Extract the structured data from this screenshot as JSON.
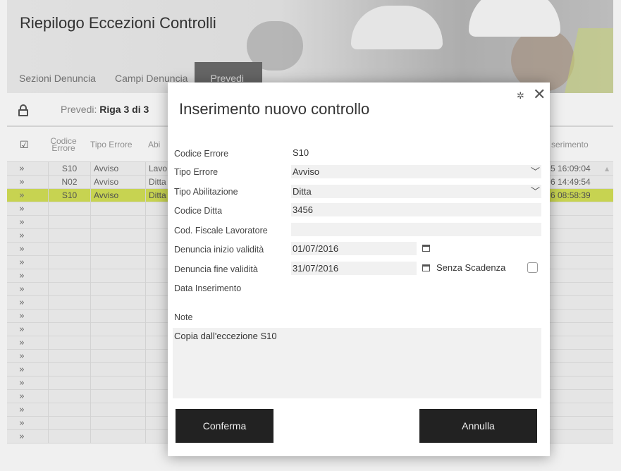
{
  "app": {
    "title": "Riepilogo Eccezioni Controlli",
    "tabs": [
      {
        "label": "Sezioni Denuncia",
        "active": false
      },
      {
        "label": "Campi Denuncia",
        "active": false
      },
      {
        "label": "Prevedi",
        "active": true
      }
    ],
    "record_prefix": "Prevedi:",
    "record_position": "Riga 3 di 3"
  },
  "table": {
    "headers": {
      "codice_errore": "Codice Errore",
      "tipo_errore": "Tipo Errore",
      "abilitazione": "Abi",
      "inserimento": "serimento"
    },
    "rows": [
      {
        "codice": "S10",
        "tipo": "Avviso",
        "abil": "Lavo",
        "inserimento": "5 16:09:04",
        "selected": false
      },
      {
        "codice": "N02",
        "tipo": "Avviso",
        "abil": "Ditta",
        "inserimento": "6 14:49:54",
        "selected": false
      },
      {
        "codice": "S10",
        "tipo": "Avviso",
        "abil": "Ditta",
        "inserimento": "6 08:58:39",
        "selected": true
      }
    ],
    "empty_rows": 18
  },
  "dialog": {
    "title": "Inserimento nuovo controllo",
    "fields": {
      "codice_errore": {
        "label": "Codice Errore",
        "value": "S10"
      },
      "tipo_errore": {
        "label": "Tipo Errore",
        "value": "Avviso"
      },
      "tipo_abilitazione": {
        "label": "Tipo Abilitazione",
        "value": "Ditta"
      },
      "codice_ditta": {
        "label": "Codice Ditta",
        "value": "3456"
      },
      "cod_fiscale": {
        "label": "Cod. Fiscale Lavoratore",
        "value": ""
      },
      "inizio_validita": {
        "label": "Denuncia inizio validità",
        "value": "01/07/2016"
      },
      "fine_validita": {
        "label": "Denuncia fine validità",
        "value": "31/07/2016"
      },
      "data_inserimento": {
        "label": "Data Inserimento",
        "value": ""
      },
      "note": {
        "label": "Note",
        "value": "Copia dall'eccezione S10"
      }
    },
    "senza_scadenza_label": "Senza Scadenza",
    "senza_scadenza_checked": false,
    "confirm_label": "Conferma",
    "cancel_label": "Annulla"
  },
  "colors": {
    "selected_row": "#d4e157",
    "button_bg": "#222222",
    "active_tab": "#6c6c6c"
  }
}
